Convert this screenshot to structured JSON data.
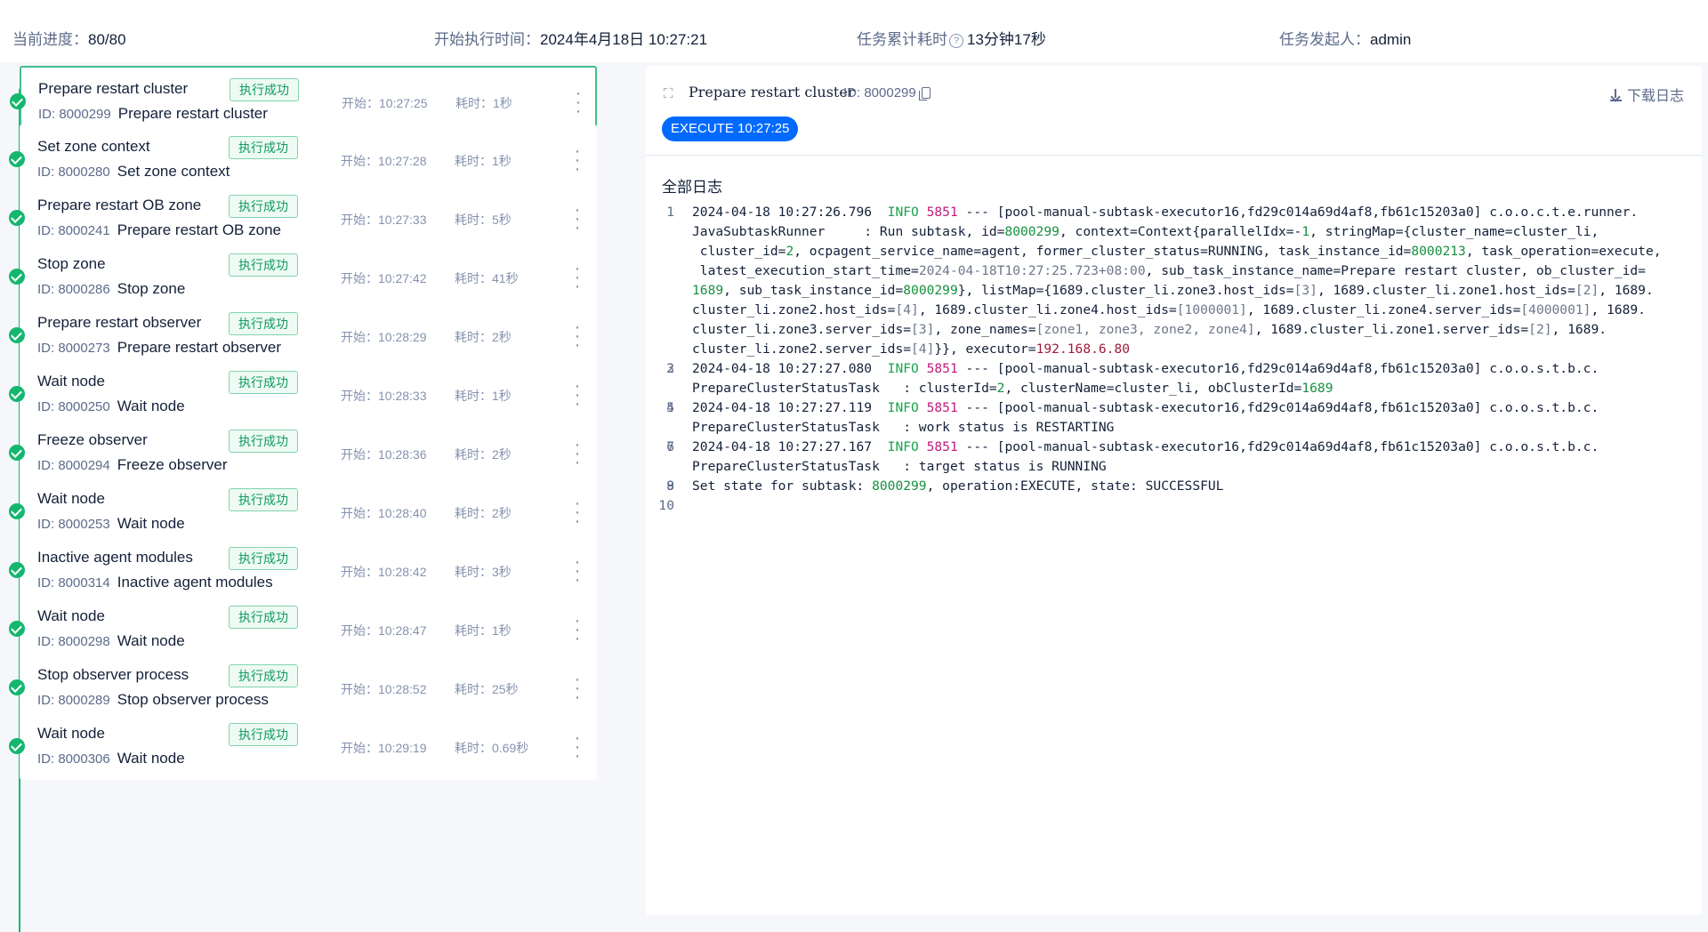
{
  "stats": [
    {
      "label": "当前进度：",
      "value": "80/80",
      "help": ""
    },
    {
      "label": "开始执行时间：",
      "value": "2024年4月18日 10:27:21",
      "help": ""
    },
    {
      "label": "任务累计耗时",
      "value": "13分钟17秒",
      "help": "?"
    },
    {
      "label": "任务发起人：",
      "value": "admin",
      "help": ""
    }
  ],
  "tasks": [
    {
      "name": "Prepare restart cluster",
      "status": "执行成功",
      "id_label": "ID: 8000299",
      "sub": "Prepare restart cluster",
      "start": "开始：10:27:25",
      "duration": "耗时：1秒"
    },
    {
      "name": "Set zone context",
      "status": "执行成功",
      "id_label": "ID: 8000280",
      "sub": "Set zone context",
      "start": "开始：10:27:28",
      "duration": "耗时：1秒"
    },
    {
      "name": "Prepare restart OB zone",
      "status": "执行成功",
      "id_label": "ID: 8000241",
      "sub": "Prepare restart OB zone",
      "start": "开始：10:27:33",
      "duration": "耗时：5秒"
    },
    {
      "name": "Stop zone",
      "status": "执行成功",
      "id_label": "ID: 8000286",
      "sub": "Stop zone",
      "start": "开始：10:27:42",
      "duration": "耗时：41秒"
    },
    {
      "name": "Prepare restart observer",
      "status": "执行成功",
      "id_label": "ID: 8000273",
      "sub": "Prepare restart observer",
      "start": "开始：10:28:29",
      "duration": "耗时：2秒"
    },
    {
      "name": "Wait node",
      "status": "执行成功",
      "id_label": "ID: 8000250",
      "sub": "Wait node",
      "start": "开始：10:28:33",
      "duration": "耗时：1秒"
    },
    {
      "name": "Freeze observer",
      "status": "执行成功",
      "id_label": "ID: 8000294",
      "sub": "Freeze observer",
      "start": "开始：10:28:36",
      "duration": "耗时：2秒"
    },
    {
      "name": "Wait node",
      "status": "执行成功",
      "id_label": "ID: 8000253",
      "sub": "Wait node",
      "start": "开始：10:28:40",
      "duration": "耗时：2秒"
    },
    {
      "name": "Inactive agent modules",
      "status": "执行成功",
      "id_label": "ID: 8000314",
      "sub": "Inactive agent modules",
      "start": "开始：10:28:42",
      "duration": "耗时：3秒"
    },
    {
      "name": "Wait node",
      "status": "执行成功",
      "id_label": "ID: 8000298",
      "sub": "Wait node",
      "start": "开始：10:28:47",
      "duration": "耗时：1秒"
    },
    {
      "name": "Stop observer process",
      "status": "执行成功",
      "id_label": "ID: 8000289",
      "sub": "Stop observer process",
      "start": "开始：10:28:52",
      "duration": "耗时：25秒"
    },
    {
      "name": "Wait node",
      "status": "执行成功",
      "id_label": "ID: 8000306",
      "sub": "Wait node",
      "start": "开始：10:29:19",
      "duration": "耗时：0.69秒"
    }
  ],
  "detail": {
    "title": "Prepare restart cluster",
    "id_label": "ID: 8000299",
    "download": "下载日志",
    "operation": "EXECUTE 10:27:25",
    "log_title": "全部日志",
    "log_lines": [
      {
        "num": "1",
        "rows": [
          [
            [
              "t",
              "2024-04-18 10:27:26.796  "
            ],
            [
              "info",
              "INFO"
            ],
            [
              "t",
              " "
            ],
            [
              "pid",
              "5851"
            ],
            [
              "t",
              " --- [pool-manual-subtask-executor16,fd29c014a69d4af8,fb61c15203a0] c.o.o.c.t.e.runner."
            ]
          ],
          [
            [
              "t",
              "JavaSubtaskRunner     : Run subtask, id="
            ],
            [
              "n",
              "8000299"
            ],
            [
              "t",
              ", context=Context{parallelIdx=-"
            ],
            [
              "n",
              "1"
            ],
            [
              "t",
              ", stringMap={cluster_name=cluster_li,"
            ]
          ],
          [
            [
              "t",
              " cluster_id="
            ],
            [
              "n",
              "2"
            ],
            [
              "t",
              ", ocpagent_service_name=agent, former_cluster_status=RUNNING, task_instance_id="
            ],
            [
              "n",
              "8000213"
            ],
            [
              "t",
              ", task_operation=execute,"
            ]
          ],
          [
            [
              "t",
              " latest_execution_start_time="
            ],
            [
              "g",
              "2024-04-18T10:27:25.723+08:00"
            ],
            [
              "t",
              ", sub_task_instance_name=Prepare restart cluster, ob_cluster_id="
            ]
          ],
          [
            [
              "n",
              "1689"
            ],
            [
              "t",
              ", sub_task_instance_id="
            ],
            [
              "n",
              "8000299"
            ],
            [
              "t",
              "}, listMap={1689.cluster_li.zone3.host_ids="
            ],
            [
              "g",
              "[3]"
            ],
            [
              "t",
              ", 1689.cluster_li.zone1.host_ids="
            ],
            [
              "g",
              "[2]"
            ],
            [
              "t",
              ", 1689."
            ]
          ],
          [
            [
              "t",
              "cluster_li.zone2.host_ids="
            ],
            [
              "g",
              "[4]"
            ],
            [
              "t",
              ", 1689.cluster_li.zone4.host_ids="
            ],
            [
              "g",
              "[1000001]"
            ],
            [
              "t",
              ", 1689.cluster_li.zone4.server_ids="
            ],
            [
              "g",
              "[4000001]"
            ],
            [
              "t",
              ", 1689."
            ]
          ],
          [
            [
              "t",
              "cluster_li.zone3.server_ids="
            ],
            [
              "g",
              "[3]"
            ],
            [
              "t",
              ", zone_names="
            ],
            [
              "g",
              "[zone1, zone3, zone2, zone4]"
            ],
            [
              "t",
              ", 1689.cluster_li.zone1.server_ids="
            ],
            [
              "g",
              "[2]"
            ],
            [
              "t",
              ", 1689."
            ]
          ],
          [
            [
              "t",
              "cluster_li.zone2.server_ids="
            ],
            [
              "g",
              "[4]"
            ],
            [
              "t",
              "}}, executor="
            ],
            [
              "ip",
              "192.168.6.80"
            ]
          ]
        ]
      },
      {
        "num": "2",
        "rows": [
          [
            [
              "t",
              ""
            ]
          ]
        ]
      },
      {
        "num": "3",
        "rows": [
          [
            [
              "t",
              "2024-04-18 10:27:27.080  "
            ],
            [
              "info",
              "INFO"
            ],
            [
              "t",
              " "
            ],
            [
              "pid",
              "5851"
            ],
            [
              "t",
              " --- [pool-manual-subtask-executor16,fd29c014a69d4af8,fb61c15203a0] c.o.o.s.t.b.c."
            ]
          ],
          [
            [
              "t",
              "PrepareClusterStatusTask   : clusterId="
            ],
            [
              "n",
              "2"
            ],
            [
              "t",
              ", clusterName=cluster_li, obClusterId="
            ],
            [
              "n",
              "1689"
            ]
          ]
        ]
      },
      {
        "num": "4",
        "rows": [
          [
            [
              "t",
              ""
            ]
          ]
        ]
      },
      {
        "num": "5",
        "rows": [
          [
            [
              "t",
              "2024-04-18 10:27:27.119  "
            ],
            [
              "info",
              "INFO"
            ],
            [
              "t",
              " "
            ],
            [
              "pid",
              "5851"
            ],
            [
              "t",
              " --- [pool-manual-subtask-executor16,fd29c014a69d4af8,fb61c15203a0] c.o.o.s.t.b.c."
            ]
          ],
          [
            [
              "t",
              "PrepareClusterStatusTask   : work status is RESTARTING"
            ]
          ]
        ]
      },
      {
        "num": "6",
        "rows": [
          [
            [
              "t",
              ""
            ]
          ]
        ]
      },
      {
        "num": "7",
        "rows": [
          [
            [
              "t",
              "2024-04-18 10:27:27.167  "
            ],
            [
              "info",
              "INFO"
            ],
            [
              "t",
              " "
            ],
            [
              "pid",
              "5851"
            ],
            [
              "t",
              " --- [pool-manual-subtask-executor16,fd29c014a69d4af8,fb61c15203a0] c.o.o.s.t.b.c."
            ]
          ],
          [
            [
              "t",
              "PrepareClusterStatusTask   : target status is RUNNING"
            ]
          ]
        ]
      },
      {
        "num": "8",
        "rows": [
          [
            [
              "t",
              ""
            ]
          ]
        ]
      },
      {
        "num": "9",
        "rows": [
          [
            [
              "t",
              "Set state for subtask: "
            ],
            [
              "n",
              "8000299"
            ],
            [
              "t",
              ", operation:EXECUTE, state: SUCCESSFUL"
            ]
          ]
        ]
      },
      {
        "num": "10",
        "rows": [
          [
            [
              "t",
              ""
            ]
          ]
        ]
      }
    ]
  },
  "colors": {
    "success": "#15b76f",
    "primary": "#006aff",
    "log_info": "#17a34a",
    "log_pid": "#c21a7a"
  },
  "icons": {
    "status": "check-circle-icon",
    "more": "more-vertical-icon",
    "expand": "expand-icon",
    "copy": "copy-icon",
    "download": "download-icon"
  }
}
